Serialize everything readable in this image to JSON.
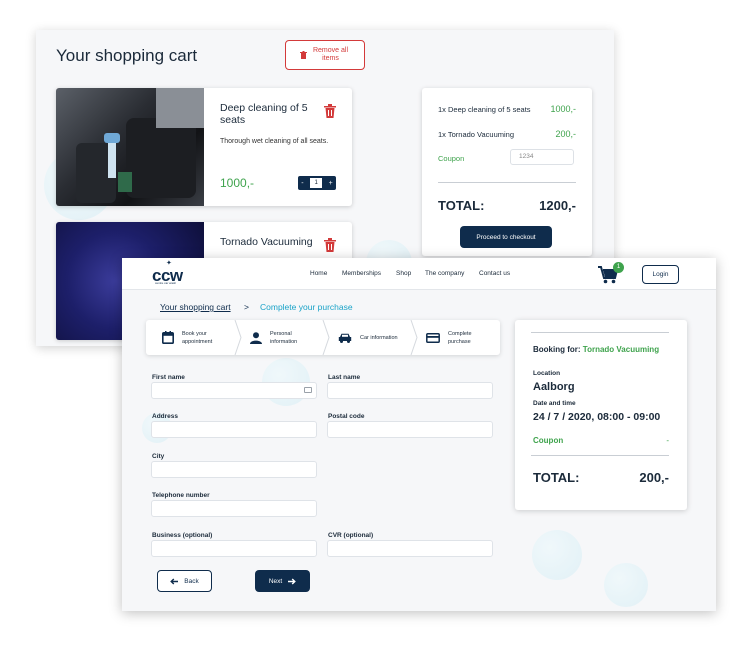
{
  "cart": {
    "title": "Your shopping cart",
    "remove_all": "Remove all items",
    "items": [
      {
        "name": "Deep cleaning of 5 seats",
        "description": "Thorough wet cleaning of all seats.",
        "price": "1000,-",
        "quantity": "1"
      },
      {
        "name": "Tornado Vacuuming"
      }
    ],
    "qty_minus": "-",
    "qty_plus": "+",
    "summary": {
      "lines": [
        {
          "label": "1x Deep cleaning of 5 seats",
          "value": "1000,-"
        },
        {
          "label": "1x Tornado Vacuuming",
          "value": "200,-"
        }
      ],
      "coupon_label": "Coupon",
      "coupon_value": "1234",
      "total_label": "TOTAL:",
      "total_value": "1200,-",
      "checkout": "Proceed to checkout"
    }
  },
  "purchase": {
    "logo": "ccw",
    "logo_tagline": "centre car wash",
    "nav": [
      "Home",
      "Memberships",
      "Shop",
      "The company",
      "Contact us"
    ],
    "cart_count": "1",
    "login": "Login",
    "breadcrumb": {
      "cart": "Your shopping cart",
      "separator": ">",
      "current": "Complete your purchase"
    },
    "steps": [
      {
        "label": "Book your appointment",
        "icon": "calendar-icon"
      },
      {
        "label": "Personal information",
        "icon": "person-icon"
      },
      {
        "label": "Car information",
        "icon": "car-icon"
      },
      {
        "label": "Complete purchase",
        "icon": "credit-card-icon"
      }
    ],
    "form": {
      "first_name": "First name",
      "last_name": "Last name",
      "address": "Address",
      "postal_code": "Postal code",
      "city": "City",
      "telephone": "Telephone number",
      "business": "Business (optional)",
      "cvr": "CVR (optional)"
    },
    "back": "Back",
    "next": "Next",
    "booking": {
      "for_label": "Booking for:",
      "for_value": "Tornado Vacuuming",
      "location_label": "Location",
      "location": "Aalborg",
      "datetime_label": "Date and time",
      "datetime": "24 / 7 / 2020, 08:00 - 09:00",
      "coupon_label": "Coupon",
      "coupon_value": "-",
      "total_label": "TOTAL:",
      "total_value": "200,-"
    }
  },
  "colors": {
    "navy": "#0f2c4c",
    "green": "#3fa34d",
    "red": "#d33a3a",
    "cyan": "#1aa3c8"
  }
}
